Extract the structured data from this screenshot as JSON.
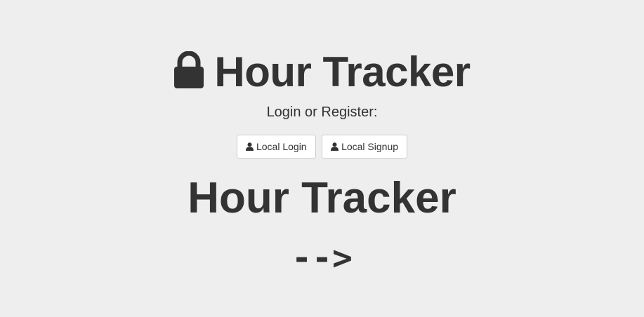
{
  "header": {
    "icon": "lock-icon",
    "title": "Hour Tracker",
    "subtitle": "Login or Register:"
  },
  "buttons": {
    "local_login": {
      "icon": "user-icon",
      "label": "Local Login"
    },
    "local_signup": {
      "icon": "user-icon",
      "label": "Local Signup"
    }
  },
  "content": {
    "heading": "Hour Tracker",
    "arrow": "-->"
  },
  "colors": {
    "background": "#eeeeee",
    "text": "#333333",
    "button_border": "#cccccc",
    "button_bg": "#ffffff"
  }
}
